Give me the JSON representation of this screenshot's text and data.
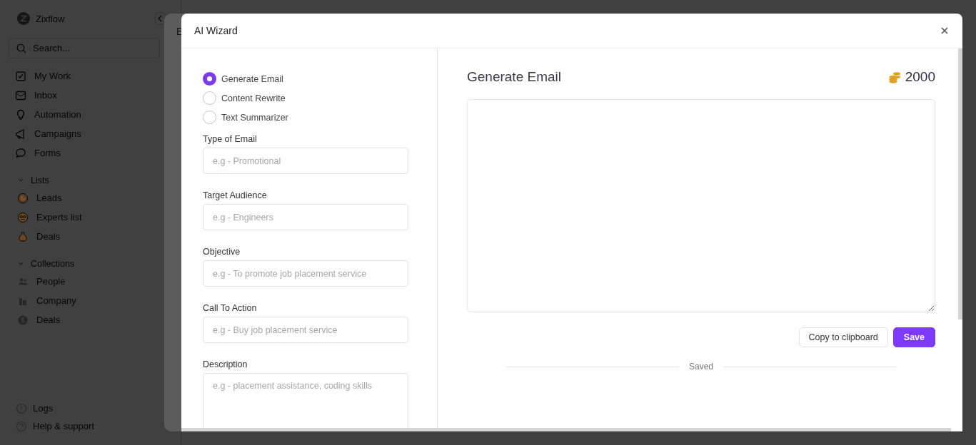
{
  "sidebar": {
    "brand": "Zixflow",
    "search": {
      "placeholder": "Search..."
    },
    "items": [
      {
        "label": "My Work"
      },
      {
        "label": "Inbox"
      },
      {
        "label": "Automation"
      },
      {
        "label": "Campaigns"
      },
      {
        "label": "Forms"
      }
    ],
    "sections": [
      {
        "title": "Lists",
        "expanded": true,
        "items": [
          {
            "label": "Leads"
          },
          {
            "label": "Experts list"
          },
          {
            "label": "Deals"
          }
        ]
      },
      {
        "title": "Collections",
        "expanded": true,
        "items": [
          {
            "label": "People"
          },
          {
            "label": "Company"
          },
          {
            "label": "Deals"
          }
        ]
      }
    ],
    "footer": [
      {
        "label": "Logs"
      },
      {
        "label": "Help & support"
      }
    ]
  },
  "back_panel": {
    "title": "E"
  },
  "modal": {
    "title": "AI Wizard",
    "modes": [
      {
        "label": "Generate Email",
        "selected": true
      },
      {
        "label": "Content Rewrite",
        "selected": false
      },
      {
        "label": "Text Summarizer",
        "selected": false
      }
    ],
    "fields": [
      {
        "label": "Type of Email",
        "placeholder": "e.g - Promotional",
        "kind": "input"
      },
      {
        "label": "Target Audience",
        "placeholder": "e.g - Engineers",
        "kind": "input"
      },
      {
        "label": "Objective",
        "placeholder": "e.g - To promote job placement service",
        "kind": "input"
      },
      {
        "label": "Call To Action",
        "placeholder": "e.g - Buy job placement service",
        "kind": "input"
      },
      {
        "label": "Description",
        "placeholder": "e.g - placement assistance, coding skills",
        "kind": "textarea"
      }
    ],
    "output": {
      "title": "Generate Email",
      "credits": "2000",
      "buttons": [
        {
          "label": "Copy to clipboard",
          "kind": "secondary"
        },
        {
          "label": "Save",
          "kind": "primary"
        }
      ],
      "status": "Saved"
    }
  }
}
